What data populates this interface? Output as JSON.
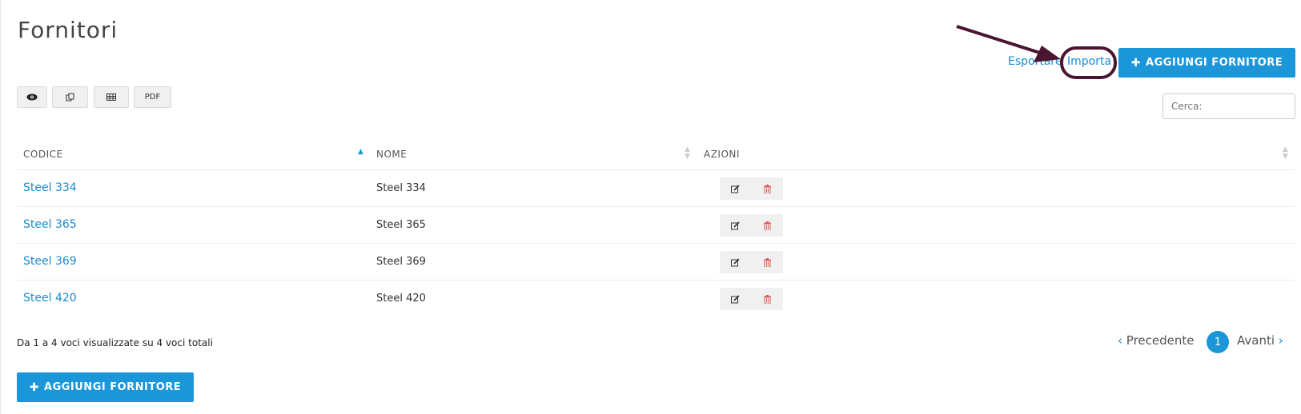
{
  "page": {
    "title": "Fornitori"
  },
  "header": {
    "export_label": "Esportare",
    "import_label": "Importa",
    "add_label": "AGGIUNGI FORNITORE"
  },
  "toolbar": {
    "buttons": [
      {
        "icon": "eye-icon"
      },
      {
        "icon": "copy-icon"
      },
      {
        "icon": "table-icon"
      },
      {
        "icon": "pdf-icon",
        "label": "PDF"
      }
    ]
  },
  "search": {
    "placeholder": "Cerca:"
  },
  "table": {
    "columns": [
      "CODICE",
      "NOME",
      "AZIONI"
    ],
    "rows": [
      {
        "code": "Steel 334",
        "name": "Steel 334"
      },
      {
        "code": "Steel 365",
        "name": "Steel 365"
      },
      {
        "code": "Steel 369",
        "name": "Steel 369"
      },
      {
        "code": "Steel 420",
        "name": "Steel 420"
      }
    ]
  },
  "footer": {
    "info": "Da 1 a 4 voci visualizzate su 4 voci totali",
    "prev_label": "Precedente",
    "next_label": "Avanti",
    "current_page": "1",
    "add_label": "AGGIUNGI FORNITORE"
  },
  "colors": {
    "accent": "#1a96d9",
    "link": "#1a8ad0",
    "delete_icon": "#e05a5a",
    "annotation": "#4a1530"
  }
}
